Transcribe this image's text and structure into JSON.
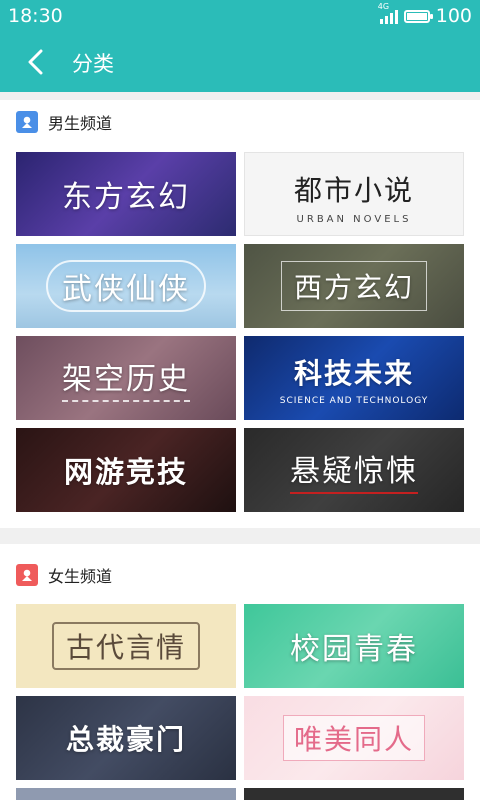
{
  "status": {
    "time": "18:30",
    "network": "4G",
    "battery": "100"
  },
  "header": {
    "title": "分类"
  },
  "male": {
    "heading": "男生频道",
    "tiles": [
      {
        "label": "东方玄幻"
      },
      {
        "label": "都市小说",
        "sub": "URBAN NOVELS"
      },
      {
        "label": "武侠仙侠"
      },
      {
        "label": "西方玄幻"
      },
      {
        "label": "架空历史"
      },
      {
        "label": "科技未来",
        "sub": "SCIENCE AND TECHNOLOGY"
      },
      {
        "label": "网游竞技"
      },
      {
        "label": "悬疑惊悚"
      }
    ]
  },
  "female": {
    "heading": "女生频道",
    "tiles": [
      {
        "label": "古代言情"
      },
      {
        "label": "校园青春"
      },
      {
        "label": "总裁豪门"
      },
      {
        "label": "唯美同人"
      }
    ]
  },
  "colors": {
    "accent": "#2bbcb8",
    "male_icon": "#4a8fe7",
    "female_icon": "#ef5b5b"
  }
}
